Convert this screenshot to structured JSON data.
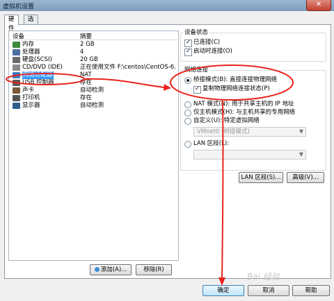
{
  "window": {
    "title": "虚拟机设置",
    "close_glyph": "✕"
  },
  "tabs": [
    {
      "label": "硬件"
    },
    {
      "label": "选项"
    }
  ],
  "device_table": {
    "headers": {
      "device": "设备",
      "summary": "摘要"
    },
    "rows": [
      {
        "device": "内存",
        "summary": "2 GB",
        "icon": "memory-icon"
      },
      {
        "device": "处理器",
        "summary": "4",
        "icon": "processor-icon"
      },
      {
        "device": "硬盘(SCSI)",
        "summary": "20 GB",
        "icon": "hard-disk-icon"
      },
      {
        "device": "CD/DVD (IDE)",
        "summary": "正在使用文件 F:\\centos\\CentOS-6....",
        "icon": "cd-dvd-icon"
      },
      {
        "device": "网络适配器",
        "summary": "NAT",
        "icon": "network-adapter-icon"
      },
      {
        "device": "USB 控制器",
        "summary": "存在",
        "icon": "usb-icon"
      },
      {
        "device": "声卡",
        "summary": "自动检测",
        "icon": "sound-card-icon"
      },
      {
        "device": "打印机",
        "summary": "存在",
        "icon": "printer-icon"
      },
      {
        "device": "显示器",
        "summary": "自动检测",
        "icon": "display-icon"
      }
    ],
    "selected_index": 4
  },
  "device_buttons": {
    "add": "添加(A)...",
    "remove": "移除(R)"
  },
  "device_status": {
    "title": "设备状态",
    "connected": "已连接(C)",
    "connect_on_power": "启动时连接(O)"
  },
  "network": {
    "title": "网络连接",
    "bridged": "桥接模式(B): 直接连接物理网络",
    "replicate": "复制物理网络连接状态(P)",
    "nat": "NAT 模式(N): 用于共享主机的 IP 地址",
    "host_only": "仅主机模式(H): 与主机共享的专用网络",
    "custom": "自定义(U): 特定虚拟网络",
    "custom_select": "VMnet0 (桥接模式)",
    "lan": "LAN 区段(L):",
    "lan_select": "",
    "lan_button": "LAN 区段(S)...",
    "advanced_button": "高级(V)..."
  },
  "footer": {
    "ok": "确定",
    "cancel": "取消",
    "help": "帮助"
  },
  "watermark": "Bai 经验",
  "colors": {
    "selection": "#3399ff",
    "annotation": "#e8231c"
  }
}
